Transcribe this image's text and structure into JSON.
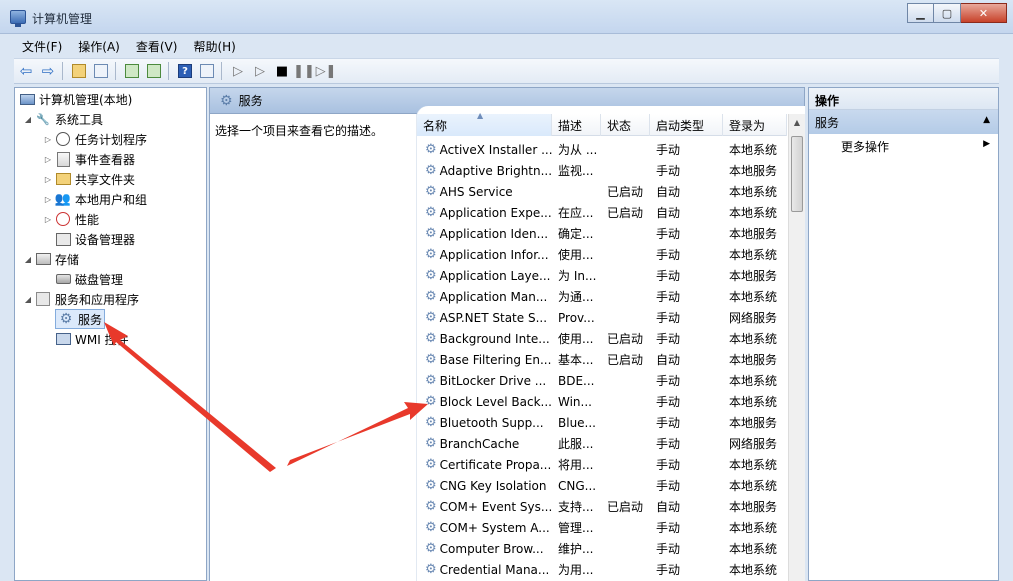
{
  "window": {
    "title": "计算机管理"
  },
  "menu": [
    "文件(F)",
    "操作(A)",
    "查看(V)",
    "帮助(H)"
  ],
  "tree": {
    "root": "计算机管理(本地)",
    "system_tools": "系统工具",
    "task_scheduler": "任务计划程序",
    "event_viewer": "事件查看器",
    "shared_folders": "共享文件夹",
    "local_users": "本地用户和组",
    "performance": "性能",
    "device_manager": "设备管理器",
    "storage": "存储",
    "disk_management": "磁盘管理",
    "services_apps": "服务和应用程序",
    "services": "服务",
    "wmi": "WMI 控件"
  },
  "center": {
    "header": "服务",
    "description_hint": "选择一个项目来查看它的描述。",
    "columns": [
      "名称",
      "描述",
      "状态",
      "启动类型",
      "登录为"
    ],
    "rows": [
      [
        "ActiveX Installer ...",
        "为从 ...",
        "",
        "手动",
        "本地系统"
      ],
      [
        "Adaptive Brightn...",
        "监视...",
        "",
        "手动",
        "本地服务"
      ],
      [
        "AHS Service",
        "",
        "已启动",
        "自动",
        "本地系统"
      ],
      [
        "Application Expe...",
        "在应...",
        "已启动",
        "自动",
        "本地系统"
      ],
      [
        "Application Iden...",
        "确定...",
        "",
        "手动",
        "本地服务"
      ],
      [
        "Application Infor...",
        "使用...",
        "",
        "手动",
        "本地系统"
      ],
      [
        "Application Laye...",
        "为 In...",
        "",
        "手动",
        "本地服务"
      ],
      [
        "Application Man...",
        "为通...",
        "",
        "手动",
        "本地系统"
      ],
      [
        "ASP.NET State S...",
        "Prov...",
        "",
        "手动",
        "网络服务"
      ],
      [
        "Background Inte...",
        "使用...",
        "已启动",
        "手动",
        "本地系统"
      ],
      [
        "Base Filtering En...",
        "基本...",
        "已启动",
        "自动",
        "本地服务"
      ],
      [
        "BitLocker Drive ...",
        "BDE...",
        "",
        "手动",
        "本地系统"
      ],
      [
        "Block Level Back...",
        "Win...",
        "",
        "手动",
        "本地系统"
      ],
      [
        "Bluetooth Supp...",
        "Blue...",
        "",
        "手动",
        "本地服务"
      ],
      [
        "BranchCache",
        "此服...",
        "",
        "手动",
        "网络服务"
      ],
      [
        "Certificate Propa...",
        "将用...",
        "",
        "手动",
        "本地系统"
      ],
      [
        "CNG Key Isolation",
        "CNG...",
        "",
        "手动",
        "本地系统"
      ],
      [
        "COM+ Event Sys...",
        "支持...",
        "已启动",
        "自动",
        "本地服务"
      ],
      [
        "COM+ System A...",
        "管理...",
        "",
        "手动",
        "本地系统"
      ],
      [
        "Computer Brow...",
        "维护...",
        "",
        "手动",
        "本地系统"
      ],
      [
        "Credential Mana...",
        "为用...",
        "",
        "手动",
        "本地系统"
      ]
    ]
  },
  "actions": {
    "title": "操作",
    "section": "服务",
    "more": "更多操作"
  },
  "colors": {
    "annotation_arrow": "#e8392b"
  }
}
